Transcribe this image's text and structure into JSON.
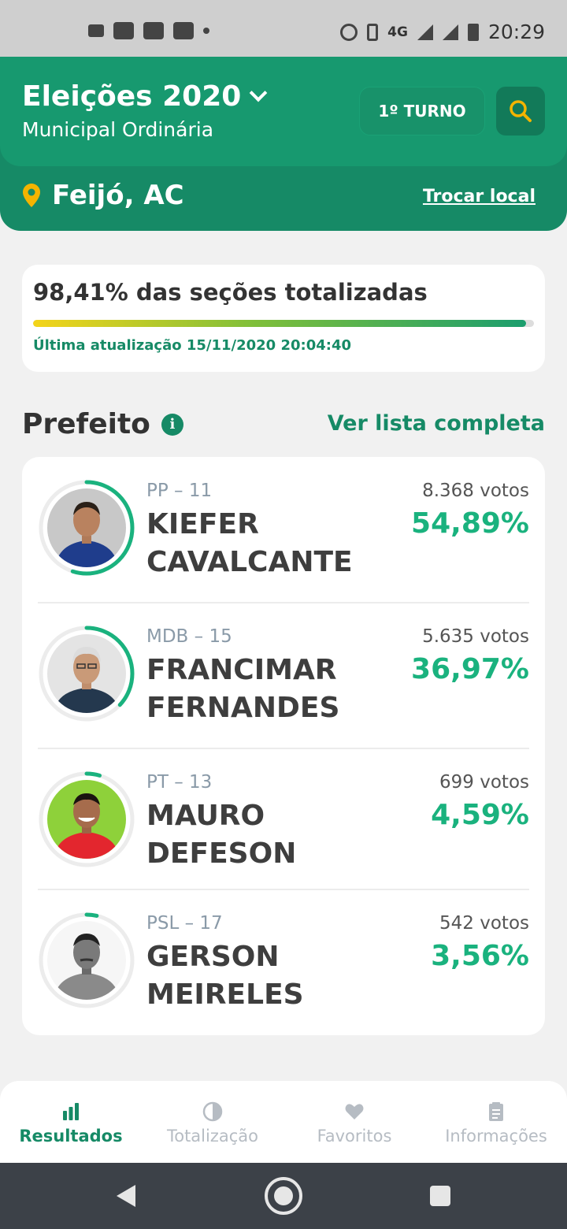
{
  "status_bar": {
    "time": "20:29",
    "network": "4G",
    "left_icons": [
      "radio-icon",
      "facebook-icon",
      "youtube-icon",
      "youtube-icon",
      "dot-icon"
    ],
    "right_icons": [
      "alarm-icon",
      "vibrate-icon",
      "signal-icon",
      "signal-icon",
      "battery-icon"
    ]
  },
  "header": {
    "title": "Eleições 2020",
    "subtitle": "Municipal Ordinária",
    "turno_label": "1º TURNO",
    "location": "Feijó, AC",
    "change_location": "Trocar local",
    "colors": {
      "primary": "#17996f",
      "dark": "#168a66",
      "accent": "#f4b400"
    }
  },
  "progress": {
    "title": "98,41% das seções totalizadas",
    "fraction": 0.9841,
    "last_update": "Última atualização 15/11/2020 20:04:40"
  },
  "section": {
    "title": "Prefeito",
    "see_all": "Ver lista completa"
  },
  "candidates": [
    {
      "party": "PP – 11",
      "name": "KIEFER CAVALCANTE",
      "votes": "8.368 votos",
      "pct": "54,89%",
      "share": 0.5489
    },
    {
      "party": "MDB – 15",
      "name": "FRANCIMAR FERNANDES",
      "votes": "5.635 votos",
      "pct": "36,97%",
      "share": 0.3697
    },
    {
      "party": "PT – 13",
      "name": "MAURO DEFESON",
      "votes": "699 votos",
      "pct": "4,59%",
      "share": 0.0459
    },
    {
      "party": "PSL – 17",
      "name": "GERSON MEIRELES",
      "votes": "542 votos",
      "pct": "3,56%",
      "share": 0.0356
    }
  ],
  "bottom_nav": [
    {
      "label": "Resultados",
      "icon": "bar-chart-icon",
      "active": true
    },
    {
      "label": "Totalização",
      "icon": "pie-icon",
      "active": false
    },
    {
      "label": "Favoritos",
      "icon": "heart-icon",
      "active": false
    },
    {
      "label": "Informações",
      "icon": "clipboard-icon",
      "active": false
    }
  ]
}
